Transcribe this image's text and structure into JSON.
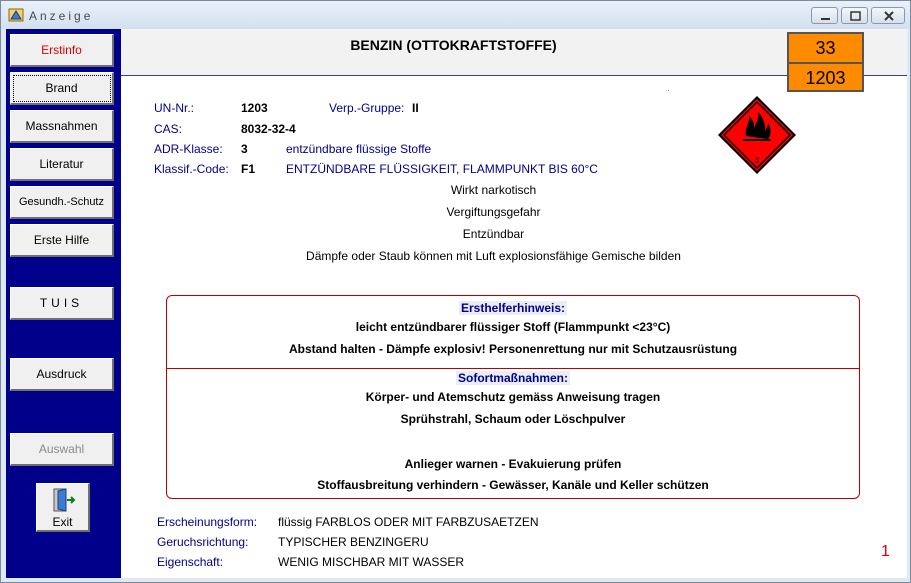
{
  "window": {
    "title": "Anzeige"
  },
  "sidebar": {
    "buttons": [
      "Erstinfo",
      "Brand",
      "Massnahmen",
      "Literatur",
      "Gesundh.-Schutz",
      "Erste Hilfe",
      "TUIS",
      "Ausdruck",
      "Auswahl"
    ],
    "exit_label": "Exit"
  },
  "substance": {
    "title": "BENZIN (OTTOKRAFTSTOFFE)",
    "hazard_number": "33",
    "un_number": "1203"
  },
  "info": {
    "un_label": "UN-Nr.:",
    "un_value": "1203",
    "packing_label": "Verp.-Gruppe:",
    "packing_value": "II",
    "cas_label": "CAS:",
    "cas_value": "8032-32-4",
    "adr_label": "ADR-Klasse:",
    "adr_value": "3",
    "adr_text": "entzündbare flüssige Stoffe",
    "code_label": "Klassif.-Code:",
    "code_value": "F1",
    "code_text": "ENTZÜNDBARE FLÜSSIGKEIT, FLAMMPUNKT BIS 60°C"
  },
  "effects": [
    "Wirkt narkotisch",
    "Vergiftungsgefahr",
    "Entzündbar",
    "Dämpfe oder Staub können mit Luft explosionsfähige Gemische bilden"
  ],
  "first_aid": {
    "heading": "Ersthelferhinweis:",
    "lines": [
      "leicht entzündbarer flüssiger Stoff (Flammpunkt <23°C)",
      "Abstand halten - Dämpfe explosiv! Personenrettung nur mit Schutzausrüstung"
    ]
  },
  "immediate": {
    "heading": "Sofortmaßnahmen:",
    "lines": [
      "Körper- und Atemschutz gemäss Anweisung tragen",
      "Sprühstrahl, Schaum oder Löschpulver",
      "Anlieger warnen - Evakuierung prüfen",
      "Stoffausbreitung verhindern - Gewässer, Kanäle und Keller schützen"
    ]
  },
  "properties": {
    "appearance_label": "Erscheinungsform:",
    "appearance_value": "flüssig FARBLOS ODER MIT FARBZUSAETZEN",
    "odor_label": "Geruchsrichtung:",
    "odor_value": "TYPISCHER BENZINGERU",
    "property_label": "Eigenschaft:",
    "property_value": "WENIG MISCHBAR MIT WASSER"
  },
  "page_number": "1",
  "colors": {
    "sidebar": "#00008b",
    "plate": "#fe8a00",
    "diamond": "#ff0000",
    "accent_red": "#e00000",
    "label_blue": "#00008b"
  }
}
